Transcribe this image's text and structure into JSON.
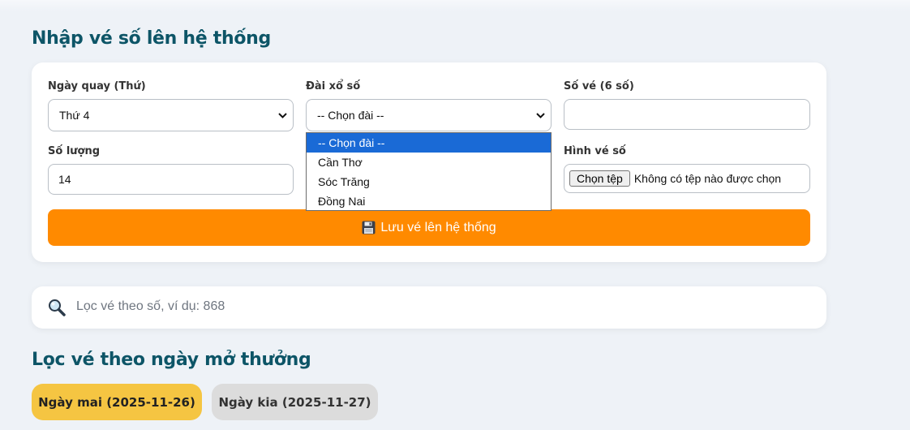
{
  "header": {
    "title": "Nhập vé số lên hệ thống"
  },
  "form": {
    "draw_day": {
      "label": "Ngày quay (Thứ)",
      "value": "Thứ 4"
    },
    "station": {
      "label": "Đài xổ số",
      "value": "-- Chọn đài --",
      "options": [
        "-- Chọn đài --",
        "Cần Thơ",
        "Sóc Trăng",
        "Đồng Nai"
      ]
    },
    "ticket_number": {
      "label": "Số vé (6 số)",
      "value": "",
      "placeholder": ""
    },
    "quantity": {
      "label": "Số lượng",
      "value": "14"
    },
    "ticket_image": {
      "label": "Hình vé số",
      "button_label": "Chọn tệp",
      "status": "Không có tệp nào được chọn"
    },
    "save_button": {
      "icon": "floppy-disk-icon",
      "label": "Lưu vé lên hệ thống"
    }
  },
  "search": {
    "icon": "magnifier-icon",
    "placeholder": "Lọc vé theo số, ví dụ: 868"
  },
  "date_filter": {
    "title": "Lọc vé theo ngày mở thưởng",
    "buttons": [
      {
        "label": "Ngày mai (2025-11-26)",
        "color": "#f5c542"
      },
      {
        "label": "Ngày kia (2025-11-27)",
        "color": "#dcdcdc"
      }
    ]
  },
  "colors": {
    "heading": "#0d5567",
    "accent": "#ff8a00",
    "selected_option": "#1a6ad6"
  }
}
